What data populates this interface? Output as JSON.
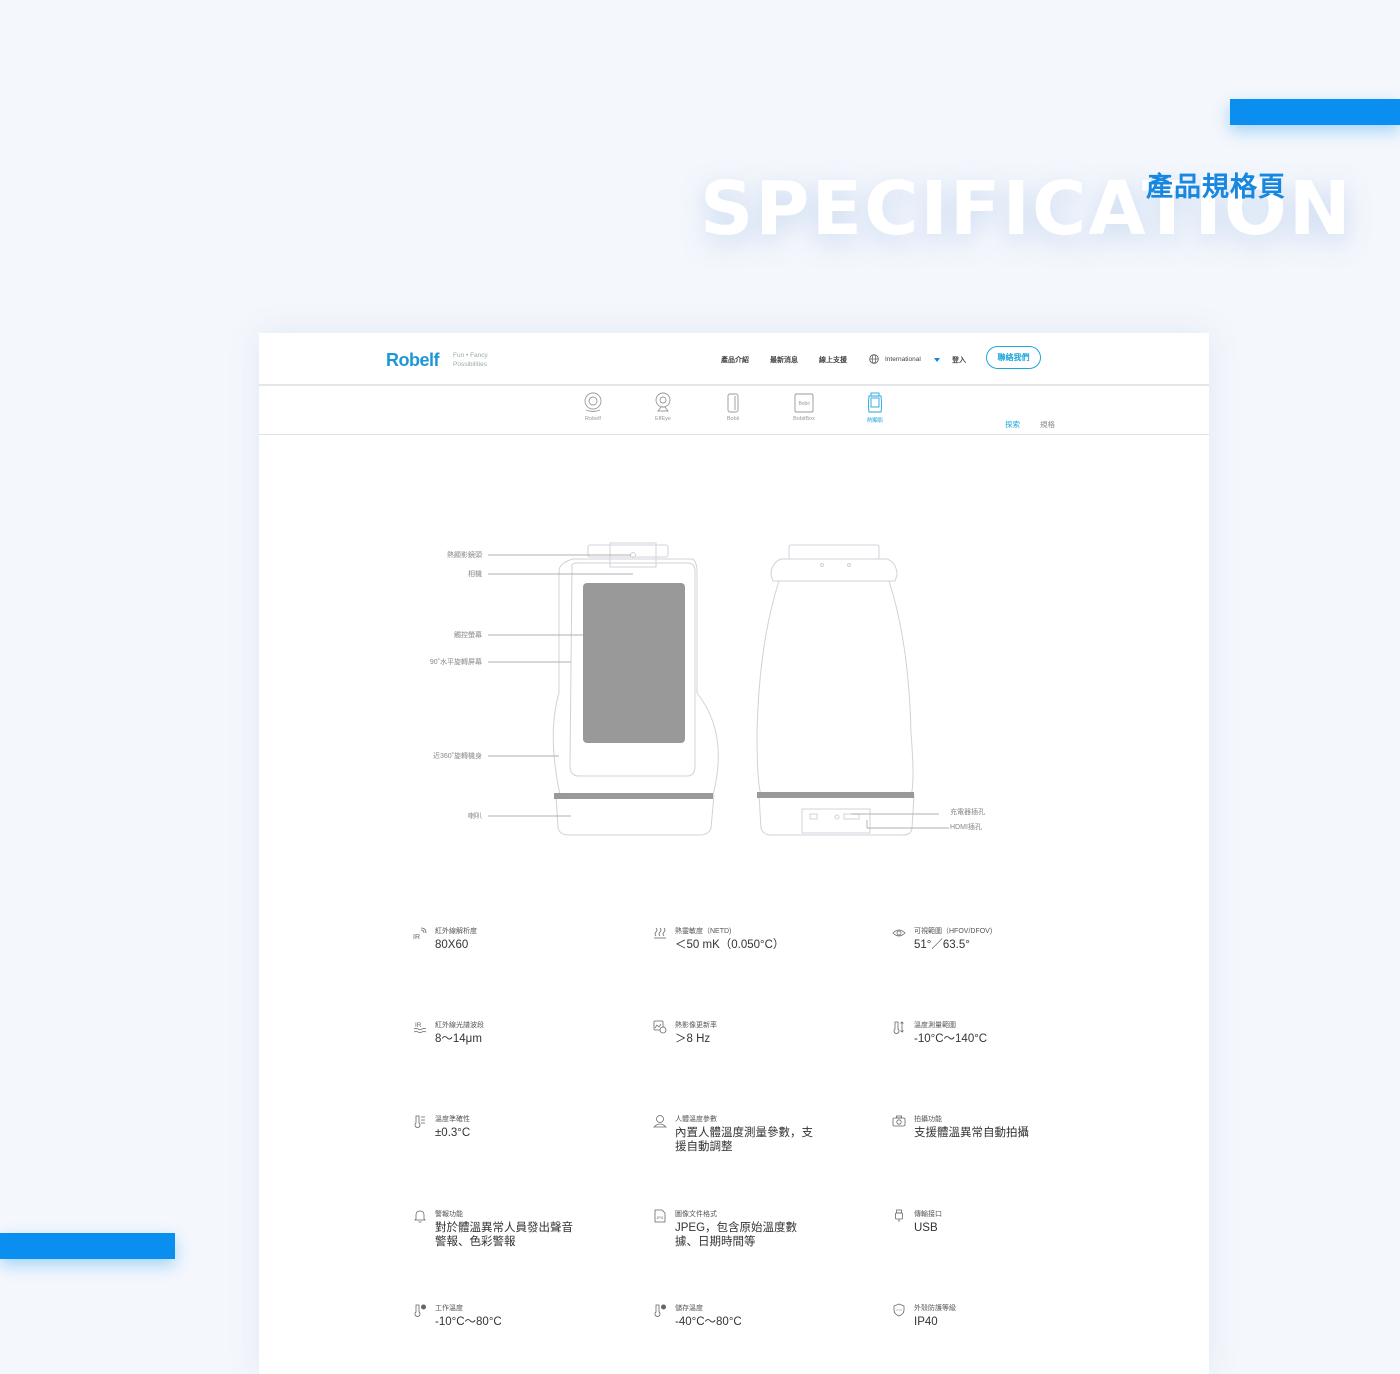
{
  "hero": {
    "background_word": "SPECIFICATION",
    "title": "產品規格頁"
  },
  "colors": {
    "accent": "#0a8ff0",
    "brand": "#1e97d6",
    "page_bg": "#f4f7fc"
  },
  "header": {
    "logo": "Robelf",
    "tagline_line1": "Fun • Fancy",
    "tagline_line2": "Possibilities",
    "nav": [
      "產品介紹",
      "最新消息",
      "線上支援"
    ],
    "language": "International",
    "login": "登入",
    "contact_button": "聯絡我們"
  },
  "products": [
    {
      "label": "Robelf",
      "icon": "robelf-icon"
    },
    {
      "label": "ElfEye",
      "icon": "elfeye-icon"
    },
    {
      "label": "Bobii",
      "icon": "bobii-icon"
    },
    {
      "label": "BobiiBox",
      "icon": "bobiibox-icon",
      "badge": "Bobii"
    },
    {
      "label": "熱顯影",
      "icon": "thermal-device-icon",
      "active": true
    }
  ],
  "subtabs": {
    "explore": "探索",
    "spec": "規格"
  },
  "callouts": {
    "thermal_lens": "熱顯影鏡頭",
    "camera": "相機",
    "touchscreen": "觸控螢幕",
    "rotate_screen": "90˚水平旋轉屏幕",
    "rotate_body": "近360˚旋轉機身",
    "speaker": "喇叭",
    "charger_port": "充電器插孔",
    "hdmi_port": "HDMI插孔"
  },
  "specs": [
    {
      "icon": "ir-resolution-icon",
      "label": "紅外線解析度",
      "value": "80X60"
    },
    {
      "icon": "heat-sensitivity-icon",
      "label": "熱靈敏度（NETD)",
      "value": "＜50 mK（0.050°C）"
    },
    {
      "icon": "eye-icon",
      "label": "可視範圍（HFOV/DFOV)",
      "value": "51°／63.5°"
    },
    {
      "icon": "ir-band-icon",
      "label": "紅外線光譜波段",
      "value": "8〜14μm"
    },
    {
      "icon": "image-refresh-icon",
      "label": "熱影像更新率",
      "value": "＞8 Hz"
    },
    {
      "icon": "thermometer-range-icon",
      "label": "溫度測量範圍",
      "value": "-10°C〜140°C"
    },
    {
      "icon": "thermometer-accuracy-icon",
      "label": "溫度準確性",
      "value": "±0.3°C"
    },
    {
      "icon": "body-temperature-icon",
      "label": "人體溫度參數",
      "value": "內置人體溫度測量參數，支援自動調整"
    },
    {
      "icon": "camera-icon",
      "label": "拍攝功能",
      "value": "支援體溫異常自動拍攝"
    },
    {
      "icon": "bell-icon",
      "label": "警報功能",
      "value": "對於體溫異常人員發出聲音警報、色彩警報"
    },
    {
      "icon": "jpeg-file-icon",
      "label": "圖像文件格式",
      "value": " JPEG，包含原始溫度數據、日期時間等"
    },
    {
      "icon": "usb-icon",
      "label": "傳輸接口",
      "value": "USB"
    },
    {
      "icon": "thermometer-work-icon",
      "label": "工作溫度",
      "value": "-10°C〜80°C"
    },
    {
      "icon": "thermometer-storage-icon",
      "label": "儲存溫度",
      "value": "-40°C〜80°C"
    },
    {
      "icon": "shield-icon",
      "label": "外殼防護等級",
      "value": "IP40"
    }
  ]
}
